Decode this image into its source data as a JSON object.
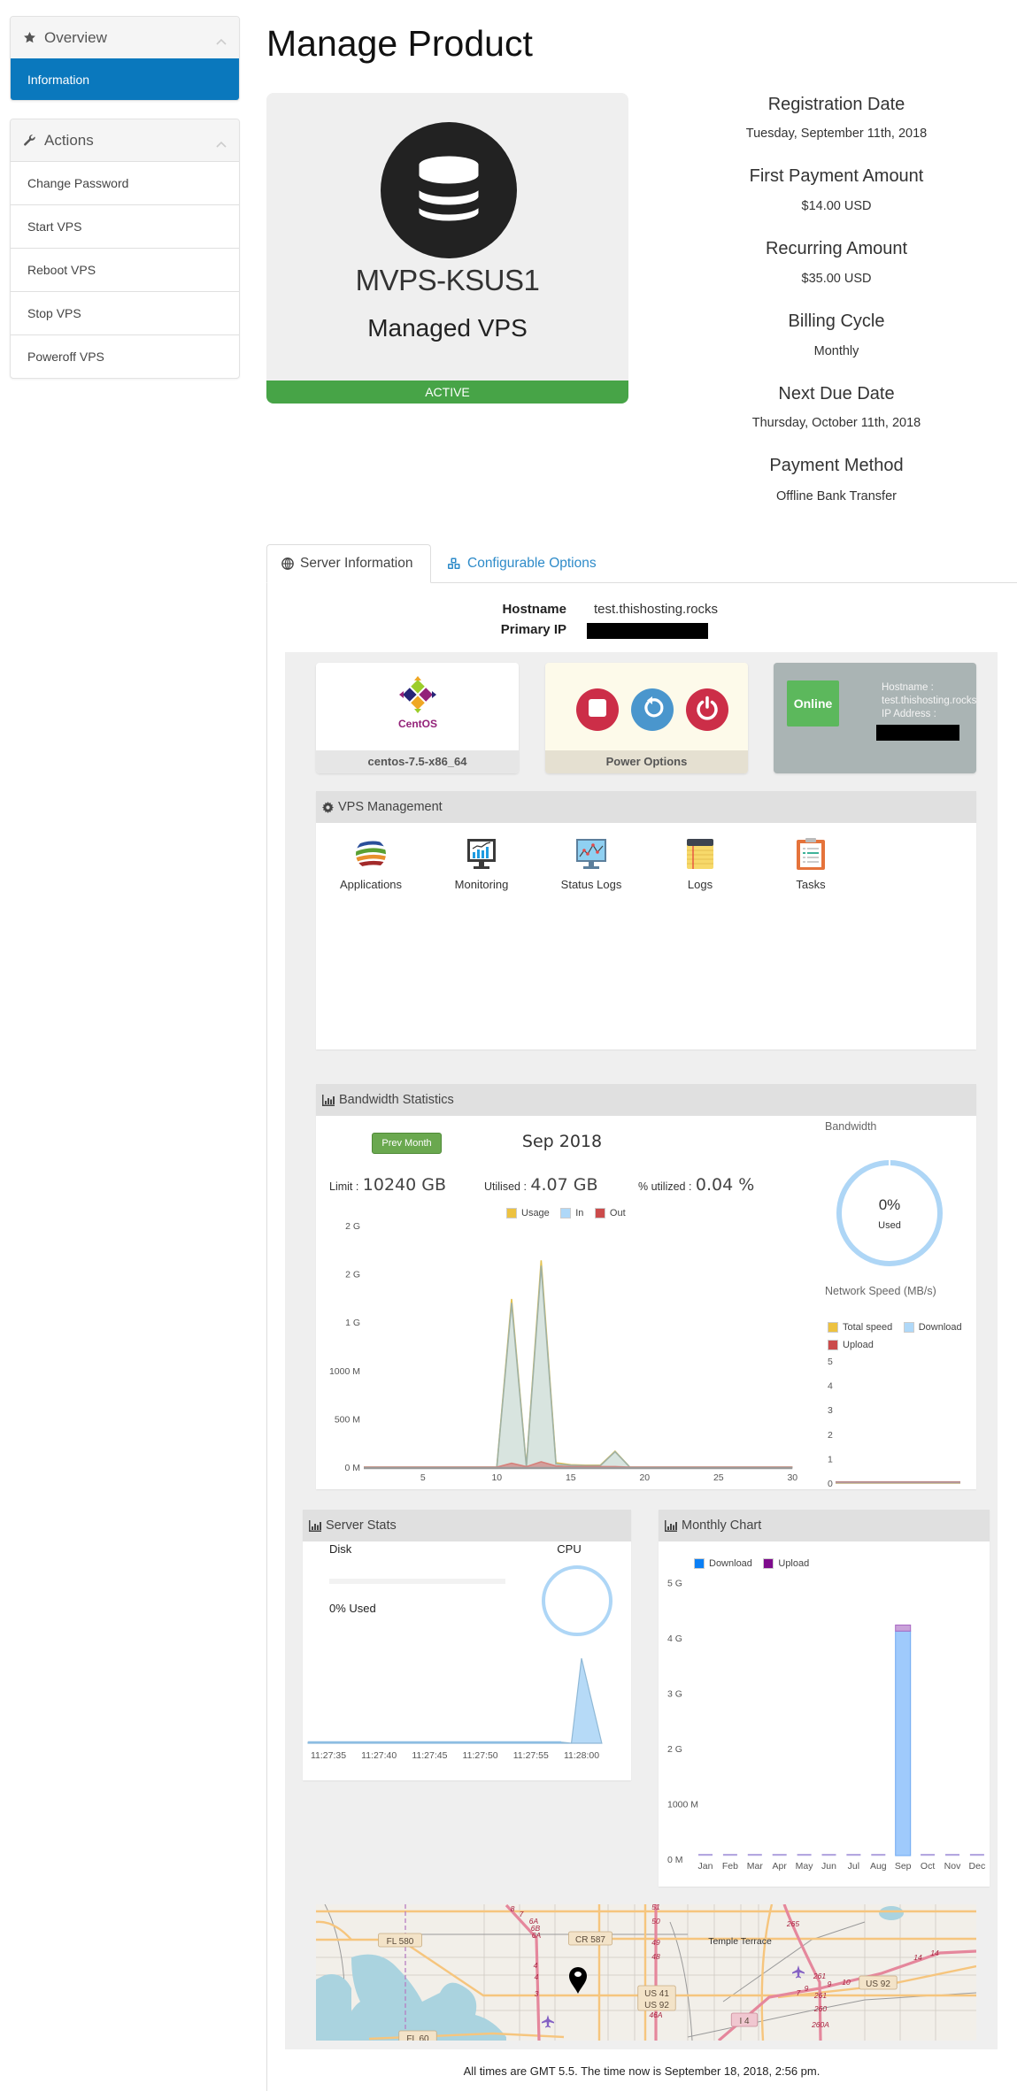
{
  "sidebar": {
    "overview": {
      "title": "Overview",
      "icon": "star-icon",
      "items": [
        {
          "label": "Information",
          "active": true
        }
      ]
    },
    "actions": {
      "title": "Actions",
      "icon": "wrench-icon",
      "items": [
        {
          "label": "Change Password"
        },
        {
          "label": "Start VPS"
        },
        {
          "label": "Reboot VPS"
        },
        {
          "label": "Stop VPS"
        },
        {
          "label": "Poweroff VPS"
        }
      ]
    }
  },
  "page_title": "Manage Product",
  "product": {
    "name": "MVPS-KSUS1",
    "group": "Managed VPS",
    "status": "ACTIVE",
    "icon": "database-icon"
  },
  "billing": [
    {
      "label": "Registration Date",
      "value": "Tuesday, September 11th, 2018"
    },
    {
      "label": "First Payment Amount",
      "value": "$14.00 USD"
    },
    {
      "label": "Recurring Amount",
      "value": "$35.00 USD"
    },
    {
      "label": "Billing Cycle",
      "value": "Monthly"
    },
    {
      "label": "Next Due Date",
      "value": "Thursday, October 11th, 2018"
    },
    {
      "label": "Payment Method",
      "value": "Offline Bank Transfer"
    }
  ],
  "tabs": [
    {
      "label": "Server Information",
      "icon": "globe-icon",
      "active": true
    },
    {
      "label": "Configurable Options",
      "icon": "cubes-icon",
      "active": false
    }
  ],
  "server_info": {
    "hostname_label": "Hostname",
    "hostname": "test.thishosting.rocks",
    "primary_ip_label": "Primary IP",
    "primary_ip_redacted": true
  },
  "os_card": {
    "logo_text": "CentOS",
    "label": "centos-7.5-x86_64"
  },
  "power_card": {
    "label": "Power Options",
    "buttons": [
      "stop",
      "restart",
      "power-off"
    ]
  },
  "status_card": {
    "status": "Online",
    "hostname_label": "Hostname :",
    "hostname": "test.thishosting.rocks",
    "ip_label": "IP Address :",
    "ip_redacted": true
  },
  "vps_management": {
    "title": "VPS Management",
    "items": [
      {
        "label": "Applications",
        "icon": "applications-icon"
      },
      {
        "label": "Monitoring",
        "icon": "monitoring-icon"
      },
      {
        "label": "Status Logs",
        "icon": "status-logs-icon"
      },
      {
        "label": "Logs",
        "icon": "logs-icon"
      },
      {
        "label": "Tasks",
        "icon": "tasks-icon"
      }
    ]
  },
  "bandwidth": {
    "title": "Bandwidth Statistics",
    "prev_button": "Prev Month",
    "period": "Sep 2018",
    "limit_label": "Limit :",
    "limit_value": "10240 GB",
    "utilised_label": "Utilised :",
    "utilised_value": "4.07 GB",
    "percent_label": "% utilized :",
    "percent_value": "0.04 %",
    "legend": [
      "Usage",
      "In",
      "Out"
    ],
    "gauge_title": "Bandwidth",
    "gauge_value": "0%",
    "gauge_sub": "Used",
    "gauge_fraction": 0,
    "speed_title": "Network Speed (MB/s)",
    "speed_legend": [
      "Total speed",
      "Download",
      "Upload"
    ]
  },
  "server_stats": {
    "title": "Server Stats",
    "disk_label": "Disk",
    "disk_used_text": "0% Used",
    "disk_fraction": 0,
    "cpu_label": "CPU"
  },
  "monthly": {
    "title": "Monthly Chart",
    "legend": [
      "Download",
      "Upload"
    ]
  },
  "map": {
    "road_labels": [
      "FL 580",
      "CR 587",
      "US 41",
      "US 92",
      "FL 60",
      "I 4",
      "US 92"
    ],
    "place_labels": [
      "Temple Terrace"
    ],
    "exit_labels": [
      "8",
      "7",
      "6A",
      "6B",
      "6A",
      "4",
      "4",
      "3",
      "51",
      "50",
      "49",
      "48",
      "46A",
      "265",
      "261",
      "261",
      "260",
      "260A",
      "7",
      "9",
      "9",
      "10",
      "14",
      "14"
    ]
  },
  "footer": "All times are GMT 5.5. The time now is September 18, 2018, 2:56 pm.",
  "colors": {
    "sidebar_active": "#0a78bd",
    "status_active": "#47a447",
    "tab_link": "#2e8bc9",
    "online": "#5cb85c",
    "status_card": "#aab4b4",
    "power_red": "#cc2e48",
    "power_blue": "#4a96cd",
    "usage": "#edc240",
    "in": "#afd8f8",
    "out": "#cb4b4b",
    "monthly_download": "#0b7ff5",
    "monthly_upload": "#7e0b8c"
  },
  "chart_data": [
    {
      "id": "bandwidth-daily",
      "type": "area",
      "title": "",
      "xlabel": "",
      "ylabel": "",
      "x": [
        1,
        2,
        3,
        4,
        5,
        6,
        7,
        8,
        9,
        10,
        11,
        12,
        13,
        14,
        15,
        16,
        17,
        18,
        19,
        20,
        21,
        22,
        23,
        24,
        25,
        26,
        27,
        28,
        29,
        30
      ],
      "xticks": [
        5,
        10,
        15,
        20,
        25,
        30
      ],
      "xlim": [
        1,
        30
      ],
      "ylim": [
        0,
        2500
      ],
      "yticks": [
        0,
        500,
        1000,
        1500,
        2000,
        2500
      ],
      "ytick_labels": [
        "0 M",
        "500 M",
        "1000 M",
        "1 G",
        "2 G",
        "2 G"
      ],
      "yunit": "MB",
      "legend": "top-center",
      "grid": false,
      "series": [
        {
          "name": "Usage",
          "color": "#edc240",
          "values": [
            0,
            0,
            0,
            0,
            0,
            0,
            0,
            0,
            0,
            0,
            1740,
            10,
            2140,
            45,
            25,
            20,
            20,
            165,
            0,
            0,
            0,
            0,
            0,
            0,
            0,
            0,
            0,
            0,
            0,
            0
          ]
        },
        {
          "name": "In",
          "color": "#afd8f8",
          "values": [
            0,
            0,
            0,
            0,
            0,
            0,
            0,
            0,
            0,
            0,
            1700,
            5,
            2085,
            33,
            20,
            15,
            15,
            160,
            0,
            0,
            0,
            0,
            0,
            0,
            0,
            0,
            0,
            0,
            0,
            0
          ]
        },
        {
          "name": "Out",
          "color": "#cb4b4b",
          "values": [
            0,
            0,
            0,
            0,
            0,
            0,
            0,
            0,
            0,
            0,
            40,
            5,
            55,
            12,
            5,
            5,
            5,
            5,
            0,
            0,
            0,
            0,
            0,
            0,
            0,
            0,
            0,
            0,
            0,
            0
          ]
        }
      ]
    },
    {
      "id": "network-speed",
      "type": "line",
      "title": "Network Speed (MB/s)",
      "ylim": [
        0,
        5
      ],
      "yticks": [
        0,
        1,
        2,
        3,
        4,
        5
      ],
      "legend": "top-left",
      "series": [
        {
          "name": "Total speed",
          "color": "#edc240",
          "values": [
            0,
            0,
            0,
            0,
            0,
            0,
            0,
            0,
            0,
            0
          ]
        },
        {
          "name": "Download",
          "color": "#afd8f8",
          "values": [
            0,
            0,
            0,
            0,
            0,
            0,
            0,
            0,
            0,
            0
          ]
        },
        {
          "name": "Upload",
          "color": "#cb4b4b",
          "values": [
            0,
            0,
            0,
            0,
            0,
            0,
            0,
            0,
            0,
            0
          ]
        }
      ]
    },
    {
      "id": "cpu-usage",
      "type": "area",
      "title": "",
      "x_seconds_from_start": [
        -2,
        23,
        24,
        25,
        27
      ],
      "x_start_label": "11:27:35",
      "xtick_labels": [
        "11:27:35",
        "11:27:40",
        "11:27:45",
        "11:27:50",
        "11:27:55",
        "11:28:00"
      ],
      "xtick_step_seconds": 5,
      "ylim": [
        0,
        100
      ],
      "yunit": "%",
      "series": [
        {
          "name": "CPU",
          "color": "#aed6f6",
          "values": [
            1,
            1,
            0,
            80,
            0
          ]
        }
      ]
    },
    {
      "id": "monthly-bandwidth",
      "type": "bar",
      "stacked": true,
      "title": "",
      "categories": [
        "Jan",
        "Feb",
        "Mar",
        "Apr",
        "May",
        "Jun",
        "Jul",
        "Aug",
        "Sep",
        "Oct",
        "Nov",
        "Dec"
      ],
      "ylim": [
        0,
        5000
      ],
      "yticks": [
        0,
        1000,
        2000,
        3000,
        4000,
        5000
      ],
      "ytick_labels": [
        "0 M",
        "1000 M",
        "2 G",
        "3 G",
        "4 G",
        "5 G"
      ],
      "yunit": "MB",
      "legend": "top-left",
      "series": [
        {
          "name": "Download",
          "color": "#0b7ff5",
          "values": [
            0,
            0,
            0,
            0,
            0,
            0,
            0,
            0,
            4060,
            0,
            0,
            0
          ]
        },
        {
          "name": "Upload",
          "color": "#7e0b8c",
          "values": [
            0,
            0,
            0,
            0,
            0,
            0,
            0,
            0,
            110,
            0,
            0,
            0
          ]
        }
      ]
    }
  ]
}
